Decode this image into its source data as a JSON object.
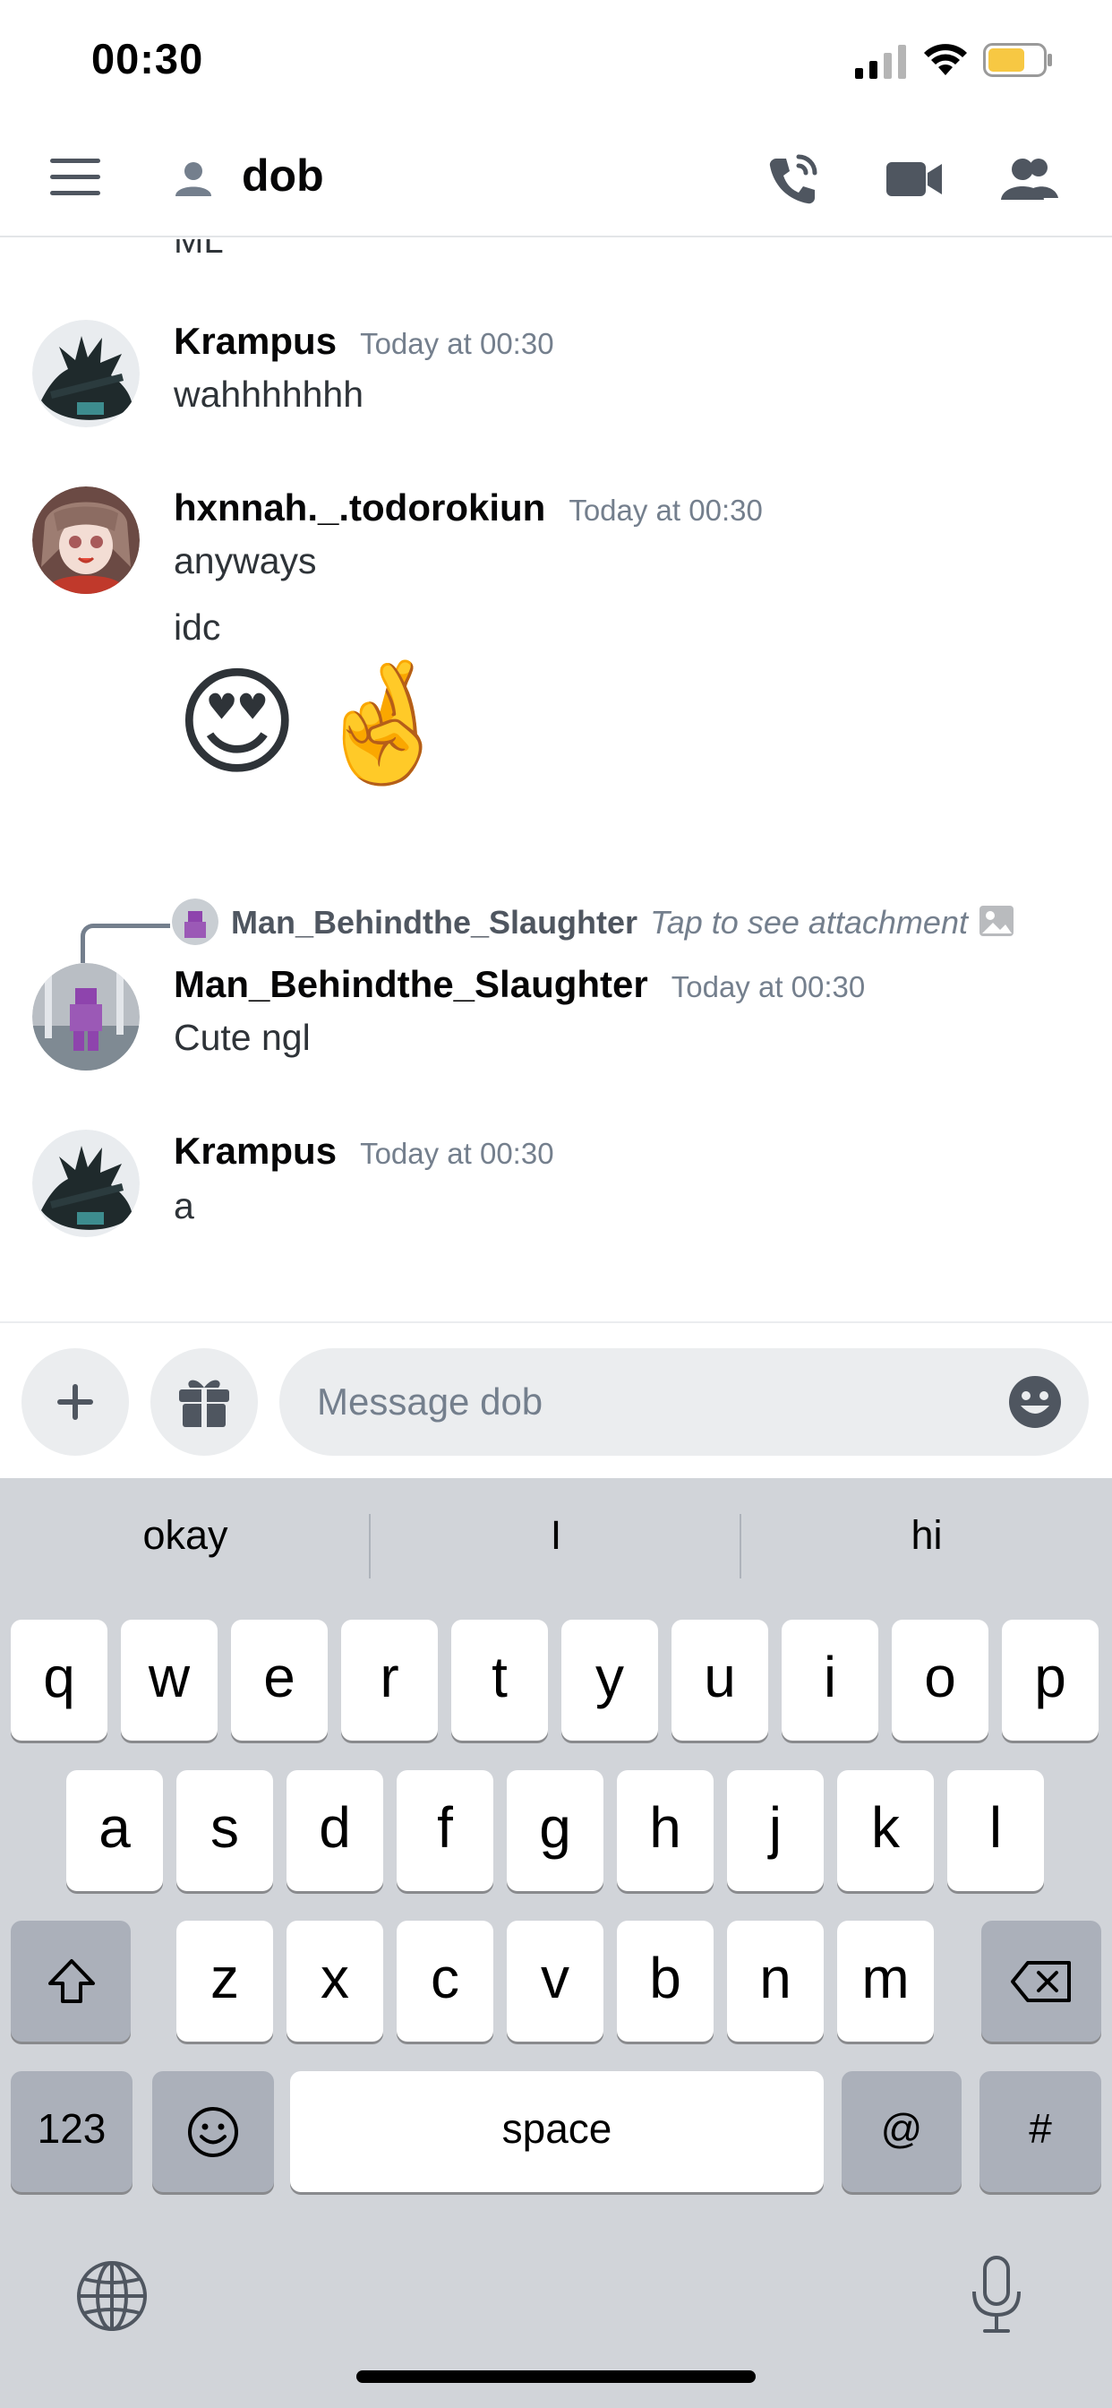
{
  "status_bar": {
    "time": "00:30"
  },
  "header": {
    "channel_name": "dob"
  },
  "messages": {
    "clipped_top_text": "ML",
    "items": [
      {
        "username": "Krampus",
        "timestamp": "Today at 00:30",
        "lines": [
          "wahhhhhhh"
        ]
      },
      {
        "username": "hxnnah._.todorokiun",
        "timestamp": "Today at 00:30",
        "lines": [
          "anyways",
          "idc"
        ],
        "emojis": [
          "😍",
          "🤞"
        ]
      },
      {
        "reply_to": {
          "username": "Man_Behindthe_Slaughter",
          "text": "Tap to see attachment"
        },
        "username": "Man_Behindthe_Slaughter",
        "timestamp": "Today at 00:30",
        "lines": [
          "Cute ngl"
        ]
      },
      {
        "username": "Krampus",
        "timestamp": "Today at 00:30",
        "lines": [
          "a"
        ]
      }
    ]
  },
  "composer": {
    "placeholder": "Message dob",
    "value": ""
  },
  "keyboard": {
    "suggestions": [
      "okay",
      "I",
      "hi"
    ],
    "row1": [
      "q",
      "w",
      "e",
      "r",
      "t",
      "y",
      "u",
      "i",
      "o",
      "p"
    ],
    "row2": [
      "a",
      "s",
      "d",
      "f",
      "g",
      "h",
      "j",
      "k",
      "l"
    ],
    "row3": [
      "z",
      "x",
      "c",
      "v",
      "b",
      "n",
      "m"
    ],
    "numbers_label": "123",
    "space_label": "space",
    "at_label": "@",
    "hash_label": "#"
  },
  "icons": {
    "menu": "hamburger-icon",
    "dm": "person-icon",
    "call": "phone-icon",
    "video": "video-camera-icon",
    "members": "people-icon",
    "add": "plus-icon",
    "gift": "gift-icon",
    "emoji": "smiley-icon",
    "shift": "shift-arrow-icon",
    "delete": "backspace-icon",
    "globe": "globe-icon",
    "mic": "microphone-icon"
  },
  "colors": {
    "battery": "#f7c843",
    "timestamp": "#747f8d",
    "input_bg": "#ebedef",
    "keyboard_bg": "#d1d4d9"
  }
}
